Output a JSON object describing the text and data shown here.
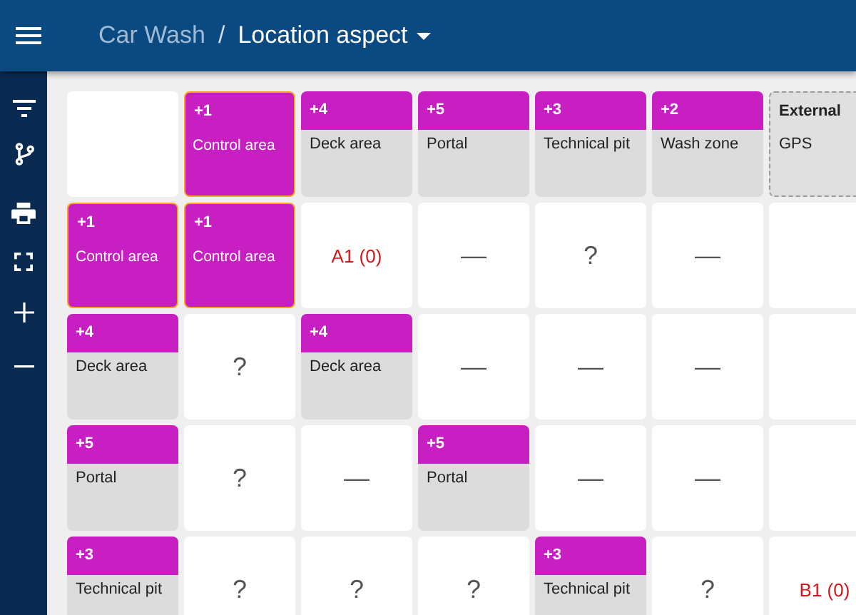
{
  "app_bar": {
    "project": "Car Wash",
    "separator": "/",
    "view": "Location aspect"
  },
  "matrix": {
    "rows": [
      [
        {
          "kind": "blank"
        },
        {
          "kind": "element",
          "count": "+1",
          "label": "Control area",
          "selected": true
        },
        {
          "kind": "element",
          "count": "+4",
          "label": "Deck area",
          "selected": false
        },
        {
          "kind": "element",
          "count": "+5",
          "label": "Portal",
          "selected": false
        },
        {
          "kind": "element",
          "count": "+3",
          "label": "Technical pit",
          "selected": false
        },
        {
          "kind": "element",
          "count": "+2",
          "label": "Wash zone",
          "selected": false
        },
        {
          "kind": "external",
          "title": "External",
          "label": "GPS"
        }
      ],
      [
        {
          "kind": "element",
          "count": "+1",
          "label": "Control area",
          "selected": true
        },
        {
          "kind": "element",
          "count": "+1",
          "label": "Control area",
          "selected": true
        },
        {
          "kind": "value",
          "text": "A1 (0)",
          "alert": true
        },
        {
          "kind": "value",
          "text": "—",
          "alert": false
        },
        {
          "kind": "value",
          "text": "?",
          "alert": false
        },
        {
          "kind": "value",
          "text": "—",
          "alert": false
        },
        {
          "kind": "blank"
        }
      ],
      [
        {
          "kind": "element",
          "count": "+4",
          "label": "Deck area",
          "selected": false
        },
        {
          "kind": "value",
          "text": "?",
          "alert": false
        },
        {
          "kind": "element",
          "count": "+4",
          "label": "Deck area",
          "selected": false
        },
        {
          "kind": "value",
          "text": "—",
          "alert": false
        },
        {
          "kind": "value",
          "text": "—",
          "alert": false
        },
        {
          "kind": "value",
          "text": "—",
          "alert": false
        },
        {
          "kind": "blank"
        }
      ],
      [
        {
          "kind": "element",
          "count": "+5",
          "label": "Portal",
          "selected": false
        },
        {
          "kind": "value",
          "text": "?",
          "alert": false
        },
        {
          "kind": "value",
          "text": "—",
          "alert": false
        },
        {
          "kind": "element",
          "count": "+5",
          "label": "Portal",
          "selected": false
        },
        {
          "kind": "value",
          "text": "—",
          "alert": false
        },
        {
          "kind": "value",
          "text": "—",
          "alert": false
        },
        {
          "kind": "blank"
        }
      ],
      [
        {
          "kind": "element",
          "count": "+3",
          "label": "Technical pit",
          "selected": false
        },
        {
          "kind": "value",
          "text": "?",
          "alert": false
        },
        {
          "kind": "value",
          "text": "?",
          "alert": false
        },
        {
          "kind": "value",
          "text": "?",
          "alert": false
        },
        {
          "kind": "element",
          "count": "+3",
          "label": "Technical pit",
          "selected": false
        },
        {
          "kind": "value",
          "text": "?",
          "alert": false
        },
        {
          "kind": "value",
          "text": "B1 (0)",
          "alert": true
        }
      ]
    ]
  }
}
